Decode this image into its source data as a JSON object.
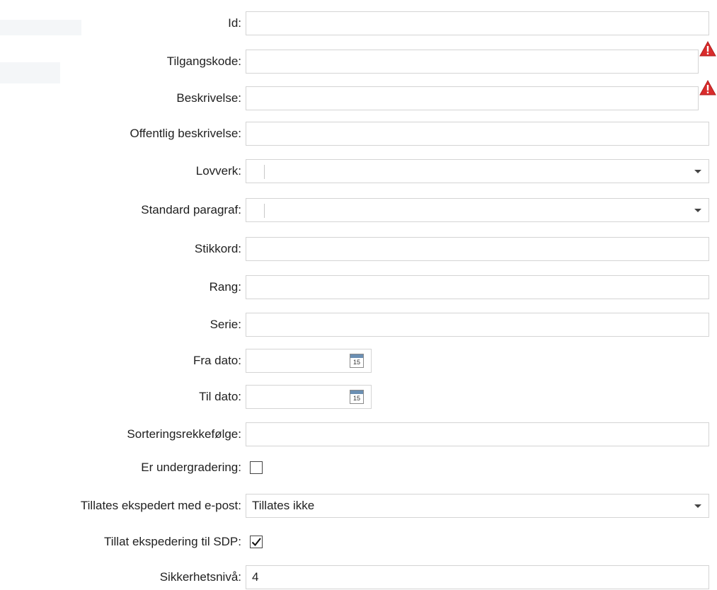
{
  "form": {
    "id": {
      "label": "Id:",
      "value": ""
    },
    "tilgangskode": {
      "label": "Tilgangskode:",
      "value": ""
    },
    "beskrivelse": {
      "label": "Beskrivelse:",
      "value": ""
    },
    "offentlig_beskrivelse": {
      "label": "Offentlig beskrivelse:",
      "value": ""
    },
    "lovverk": {
      "label": "Lovverk:",
      "value": ""
    },
    "standard_paragraf": {
      "label": "Standard paragraf:",
      "value": ""
    },
    "stikkord": {
      "label": "Stikkord:",
      "value": ""
    },
    "rang": {
      "label": "Rang:",
      "value": ""
    },
    "serie": {
      "label": "Serie:",
      "value": ""
    },
    "fra_dato": {
      "label": "Fra dato:",
      "value": "",
      "calendar_day": "15"
    },
    "til_dato": {
      "label": "Til dato:",
      "value": "",
      "calendar_day": "15"
    },
    "sorteringsrekkefolge": {
      "label": "Sorteringsrekkefølge:",
      "value": ""
    },
    "er_undergradering": {
      "label": "Er undergradering:",
      "checked": false
    },
    "tillates_ekspedert": {
      "label": "Tillates ekspedert med e-post:",
      "value": "Tillates ikke"
    },
    "tillat_sdp": {
      "label": "Tillat ekspedering til SDP:",
      "checked": true
    },
    "sikkerhetsniva": {
      "label": "Sikkerhetsnivå:",
      "value": "4"
    }
  },
  "icons": {
    "warning": "warning-icon",
    "dropdown": "chevron-down-icon",
    "calendar": "calendar-icon",
    "checkmark": "checkmark-icon"
  },
  "colors": {
    "warning": "#d92b2b",
    "border": "#d4d4d4"
  }
}
